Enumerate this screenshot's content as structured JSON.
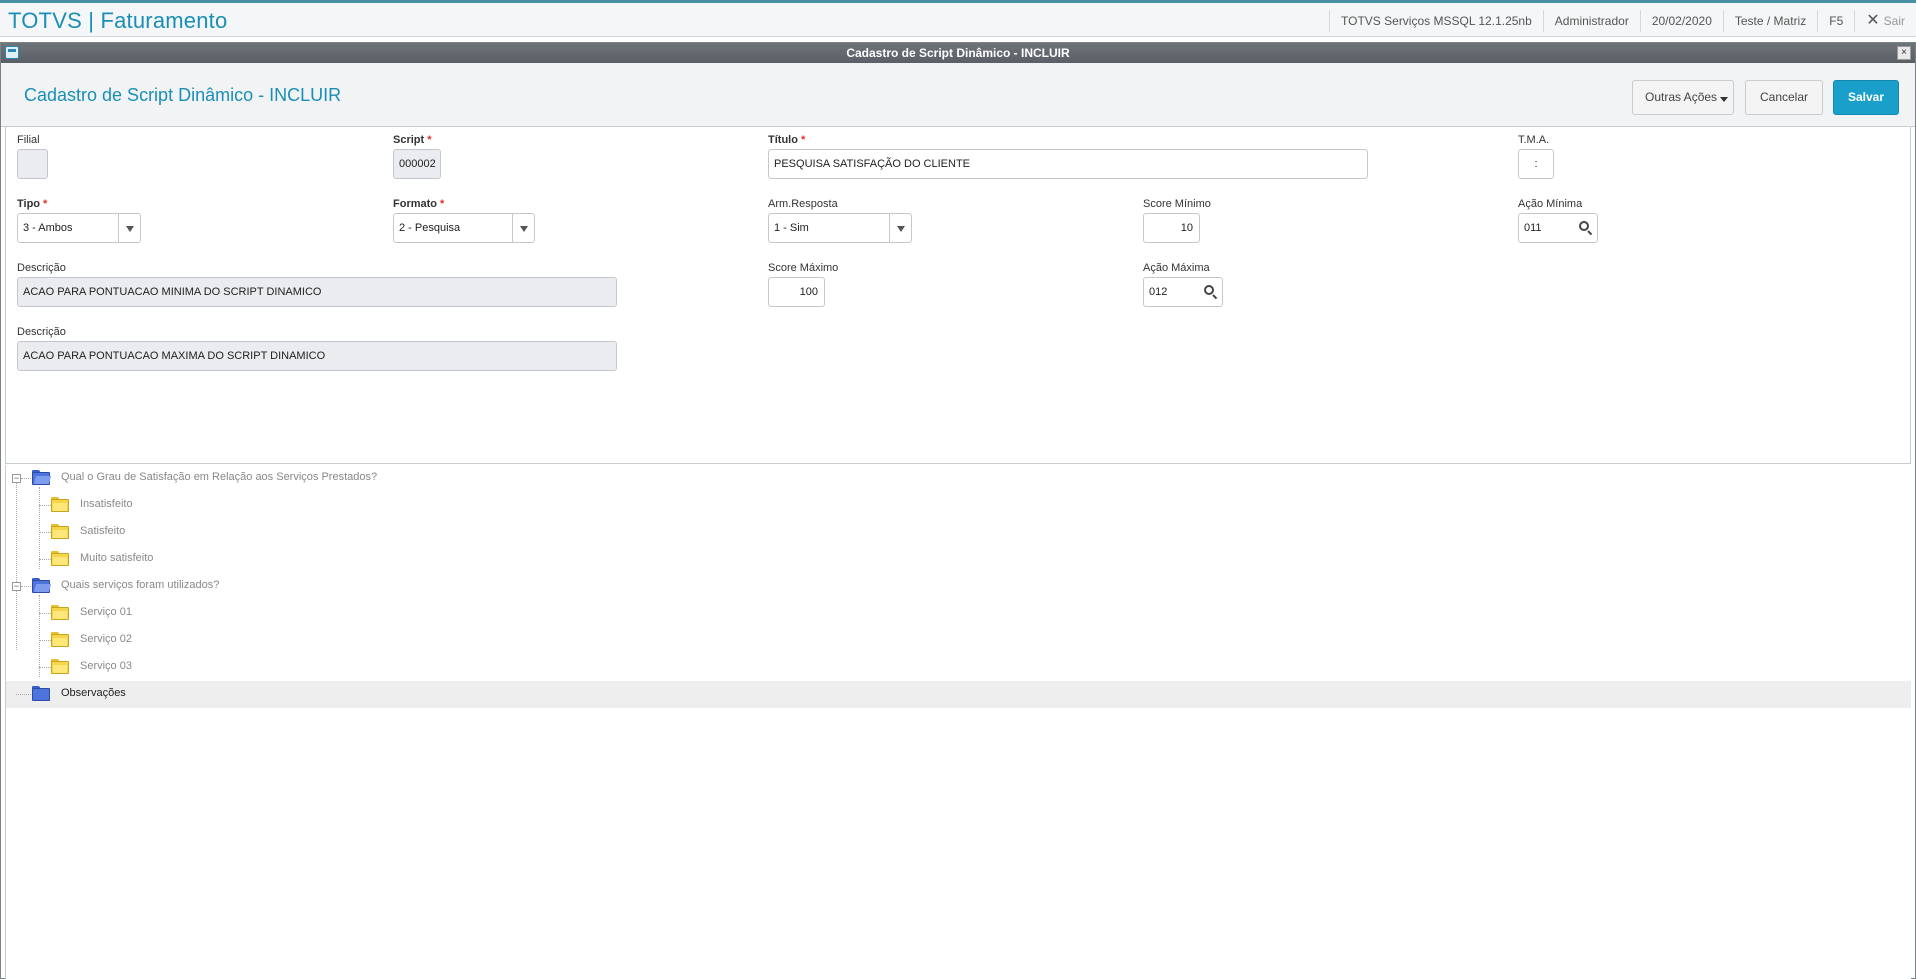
{
  "app": {
    "title": "TOTVS | Faturamento",
    "environment": "TOTVS Serviços MSSQL 12.1.25nb",
    "user": "Administrador",
    "date": "20/02/2020",
    "company": "Teste / Matriz",
    "shortcut": "F5",
    "exit_label": "Sair"
  },
  "window": {
    "title": "Cadastro de Script Dinâmico - INCLUIR",
    "close_glyph": "×"
  },
  "header": {
    "title": "Cadastro de Script Dinâmico - INCLUIR",
    "buttons": {
      "outras_acoes": "Outras Ações",
      "cancelar": "Cancelar",
      "salvar": "Salvar"
    }
  },
  "form": {
    "filial": {
      "label": "Filial",
      "value": ""
    },
    "script": {
      "label": "Script",
      "value": "000002"
    },
    "titulo": {
      "label": "Título",
      "value": "PESQUISA SATISFAÇÃO DO CLIENTE"
    },
    "tma": {
      "label": "T.M.A.",
      "value": ":"
    },
    "tipo": {
      "label": "Tipo",
      "value": "3 - Ambos"
    },
    "formato": {
      "label": "Formato",
      "value": "2 - Pesquisa"
    },
    "arm_resposta": {
      "label": "Arm.Resposta",
      "value": "1 - Sim"
    },
    "score_minimo": {
      "label": "Score Mínimo",
      "value": "10"
    },
    "acao_minima": {
      "label": "Ação Mínima",
      "value": "011"
    },
    "descricao_min": {
      "label": "Descrição",
      "value": "ACAO PARA PONTUACAO MINIMA DO SCRIPT DINAMICO"
    },
    "score_maximo": {
      "label": "Score Máximo",
      "value": "100"
    },
    "acao_maxima": {
      "label": "Ação Máxima",
      "value": "012"
    },
    "descricao_max": {
      "label": "Descrição",
      "value": "ACAO PARA PONTUACAO MAXIMA DO SCRIPT DINAMICO"
    },
    "required_mark": "*"
  },
  "tree": {
    "question1": "Qual o Grau de Satisfação em Relação aos Serviços Prestados?",
    "q1_answers": [
      "Insatisfeito",
      "Satisfeito",
      "Muito satisfeito"
    ],
    "question2": "Quais serviços foram utilizados?",
    "q2_answers": [
      "Serviço 01",
      "Serviço 02",
      "Serviço 03"
    ],
    "observacoes": "Observações",
    "collapse_glyph": "−"
  }
}
